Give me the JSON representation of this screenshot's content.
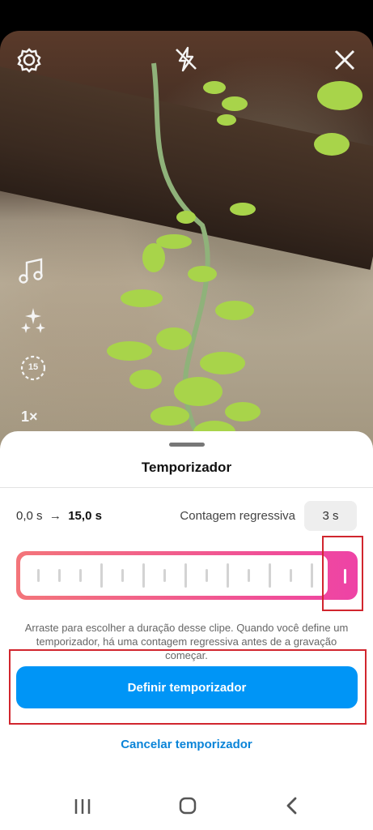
{
  "camera_controls": {
    "icons": [
      "gear-icon",
      "flash-off-icon",
      "close-icon",
      "music-icon",
      "sparkle-effects-icon",
      "timer-15-icon",
      "speed-icon"
    ],
    "timer_badge": "15",
    "speed_label": "1×"
  },
  "sheet": {
    "title": "Temporizador",
    "range_start": "0,0 s",
    "range_arrow": "→",
    "range_end": "15,0 s",
    "countdown_label": "Contagem regressiva",
    "countdown_value": "3 s",
    "slider_value_fraction": 1.0,
    "description": "Arraste para escolher a duração desse clipe. Quando você define um temporizador, há uma contagem regressiva antes de a gravação começar.",
    "primary_button": "Definir temporizador",
    "secondary_link": "Cancelar temporizador"
  },
  "colors": {
    "primary_button": "#0095f6",
    "link": "#0a84d8",
    "slider_gradient_start": "#f3757a",
    "slider_gradient_end": "#ee43a6",
    "highlight_box": "#d1262e"
  },
  "nav_bar": {
    "icons": [
      "recent-apps-icon",
      "home-icon",
      "back-icon"
    ]
  }
}
